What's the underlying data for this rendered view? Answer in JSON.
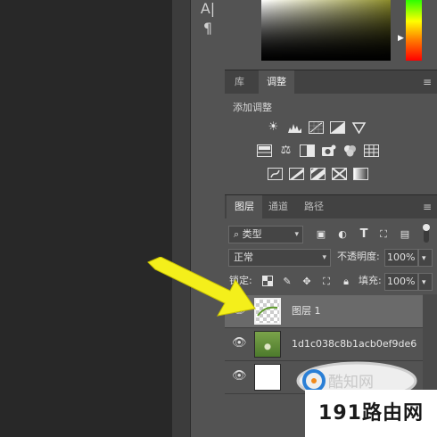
{
  "tools": {
    "type_tool": "A|",
    "paragraph_tool": "¶"
  },
  "adjust_panel": {
    "tabs": [
      "库",
      "调整"
    ],
    "heading": "添加调整"
  },
  "layers_panel": {
    "tabs": [
      "图层",
      "通道",
      "路径"
    ],
    "filter_kind": "类型",
    "blend_mode": "正常",
    "opacity_label": "不透明度:",
    "opacity_value": "100%",
    "lock_label": "锁定:",
    "fill_label": "填充:",
    "fill_value": "100%",
    "layers": [
      {
        "name": "图层 1",
        "thumbnail": "transparent",
        "selected": true
      },
      {
        "name": "1d1c038c8b1acb0ef9de6...",
        "thumbnail": "photo",
        "selected": false
      },
      {
        "name": "",
        "thumbnail": "white",
        "selected": false
      }
    ]
  },
  "watermark": {
    "site_text": "191路由网",
    "logo_text": "酷知网"
  }
}
